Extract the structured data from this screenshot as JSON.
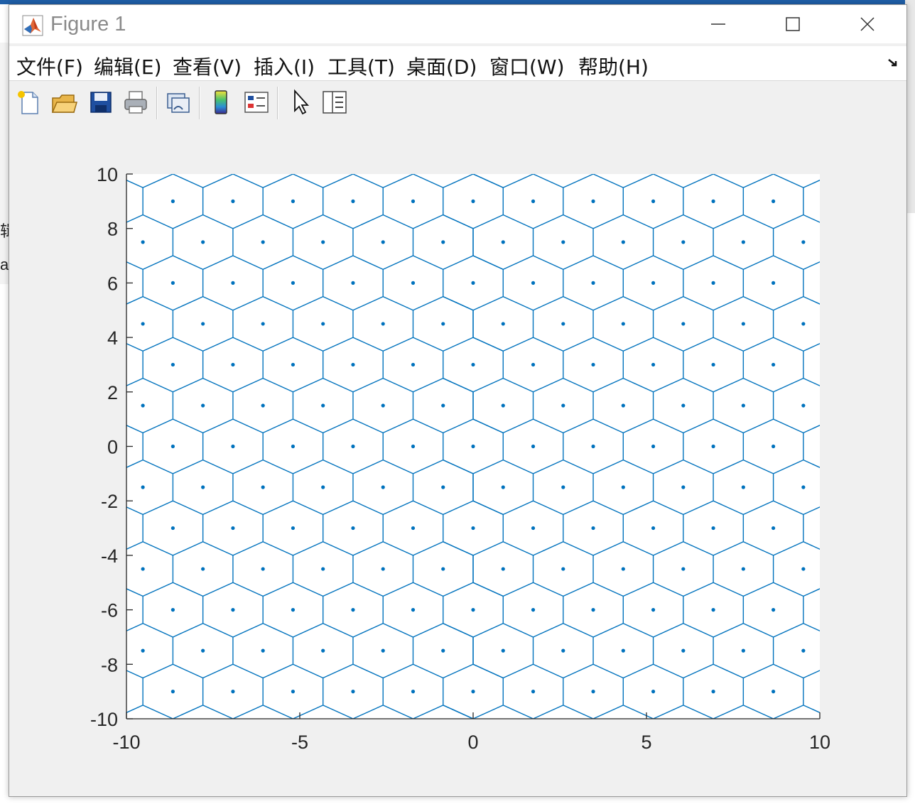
{
  "window": {
    "title": "Figure 1"
  },
  "menu": {
    "items": [
      "文件(F)",
      "编辑(E)",
      "查看(V)",
      "插入(I)",
      "工具(T)",
      "桌面(D)",
      "窗口(W)",
      "帮助(H)"
    ]
  },
  "toolbar": {
    "buttons": [
      "new-figure-icon",
      "open-file-icon",
      "save-icon",
      "print-icon",
      "link-plot-icon",
      "insert-colorbar-icon",
      "insert-legend-icon",
      "edit-plot-icon",
      "property-inspector-icon"
    ]
  },
  "background_fragments": [
    "辑",
    "av"
  ],
  "colors": {
    "line": "#0072BD",
    "axes_bg": "#ffffff",
    "figure_bg": "#f0f0f0"
  },
  "chart_data": {
    "type": "voronoi",
    "description_of_marks": "hexagonal Voronoi diagram of a triangular lattice of generator points",
    "title": "",
    "xlabel": "",
    "ylabel": "",
    "xlim": [
      -10,
      10
    ],
    "ylim": [
      -10,
      10
    ],
    "xticks": [
      -10,
      -5,
      0,
      5,
      10
    ],
    "yticks": [
      -10,
      -8,
      -6,
      -4,
      -2,
      0,
      2,
      4,
      6,
      8,
      10
    ],
    "grid": false,
    "lattice": {
      "row_y": [
        -9,
        -7.5,
        -6,
        -4.5,
        -3,
        -1.5,
        0,
        1.5,
        3,
        4.5,
        6,
        7.5,
        9
      ],
      "even_row_x_start": -8.66,
      "odd_row_x_start": -9.526,
      "x_step": 1.732,
      "points_per_row": 11,
      "first_row_is_even": true
    }
  }
}
